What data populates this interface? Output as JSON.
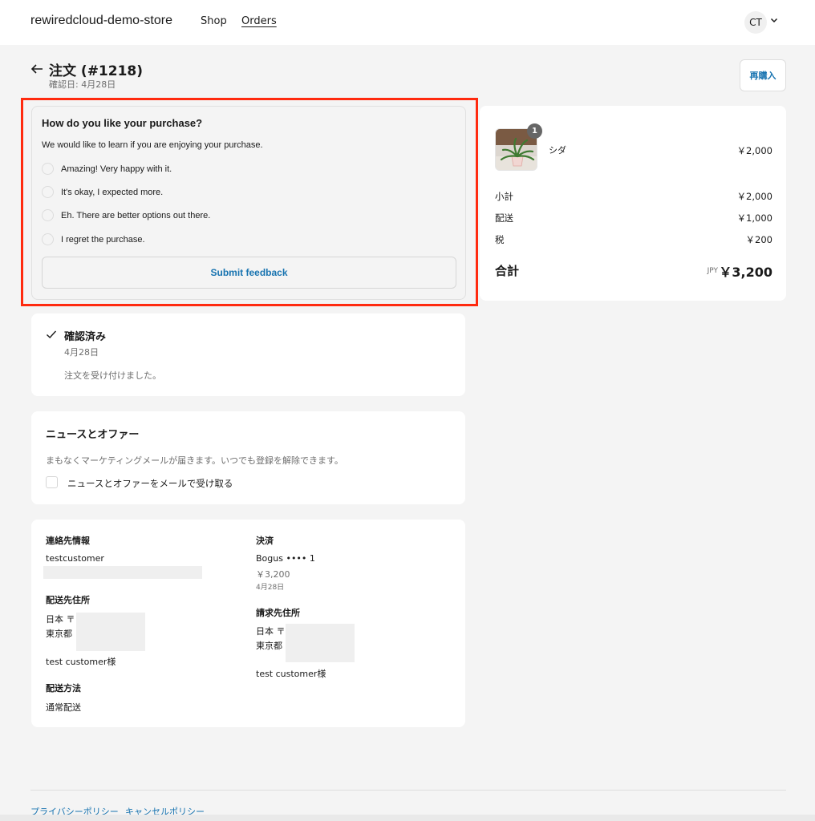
{
  "header": {
    "store_name": "rewiredcloud-demo-store",
    "nav_shop": "Shop",
    "nav_orders": "Orders",
    "avatar_initials": "CT"
  },
  "order": {
    "title": "注文 (#1218)",
    "confirmed": "確認日: 4月28日",
    "rebuy_label": "再購入"
  },
  "survey": {
    "title": "How do you like your purchase?",
    "description": "We would like to learn if you are enjoying your purchase.",
    "options": [
      "Amazing! Very happy with it.",
      "It's okay, I expected more.",
      "Eh. There are better options out there.",
      "I regret the purchase."
    ],
    "submit_label": "Submit feedback"
  },
  "status": {
    "title": "確認済み",
    "date": "4月28日",
    "message": "注文を受け付けました。"
  },
  "news": {
    "title": "ニュースとオファー",
    "description": "まもなくマーケティングメールが届きます。いつでも登録を解除できます。",
    "checkbox_label": "ニュースとオファーをメールで受け取る"
  },
  "info": {
    "contact": {
      "heading": "連絡先情報",
      "name": "testcustomer"
    },
    "shipping_address": {
      "heading": "配送先住所",
      "line1": "日本 〒",
      "line2": "東京都",
      "recipient": "test customer様"
    },
    "shipping_method": {
      "heading": "配送方法",
      "value": "通常配送"
    },
    "payment": {
      "heading": "決済",
      "method": "Bogus •••• 1",
      "amount": "￥3,200",
      "date": "4月28日"
    },
    "billing_address": {
      "heading": "請求先住所",
      "line1": "日本 〒",
      "line2": "東京都",
      "recipient": "test customer様"
    }
  },
  "summary": {
    "item": {
      "name": "シダ",
      "price": "￥2,000",
      "quantity": "1"
    },
    "subtotal_label": "小計",
    "subtotal": "￥2,000",
    "shipping_label": "配送",
    "shipping": "￥1,000",
    "tax_label": "税",
    "tax": "￥200",
    "total_label": "合計",
    "currency": "JPY",
    "total": "￥3,200"
  },
  "footer": {
    "privacy": "プライバシーポリシー",
    "cancel": "キャンセルポリシー"
  },
  "colors": {
    "accent": "#1773b0",
    "highlight_border": "#ff2a0f",
    "background": "#f4f4f4"
  }
}
